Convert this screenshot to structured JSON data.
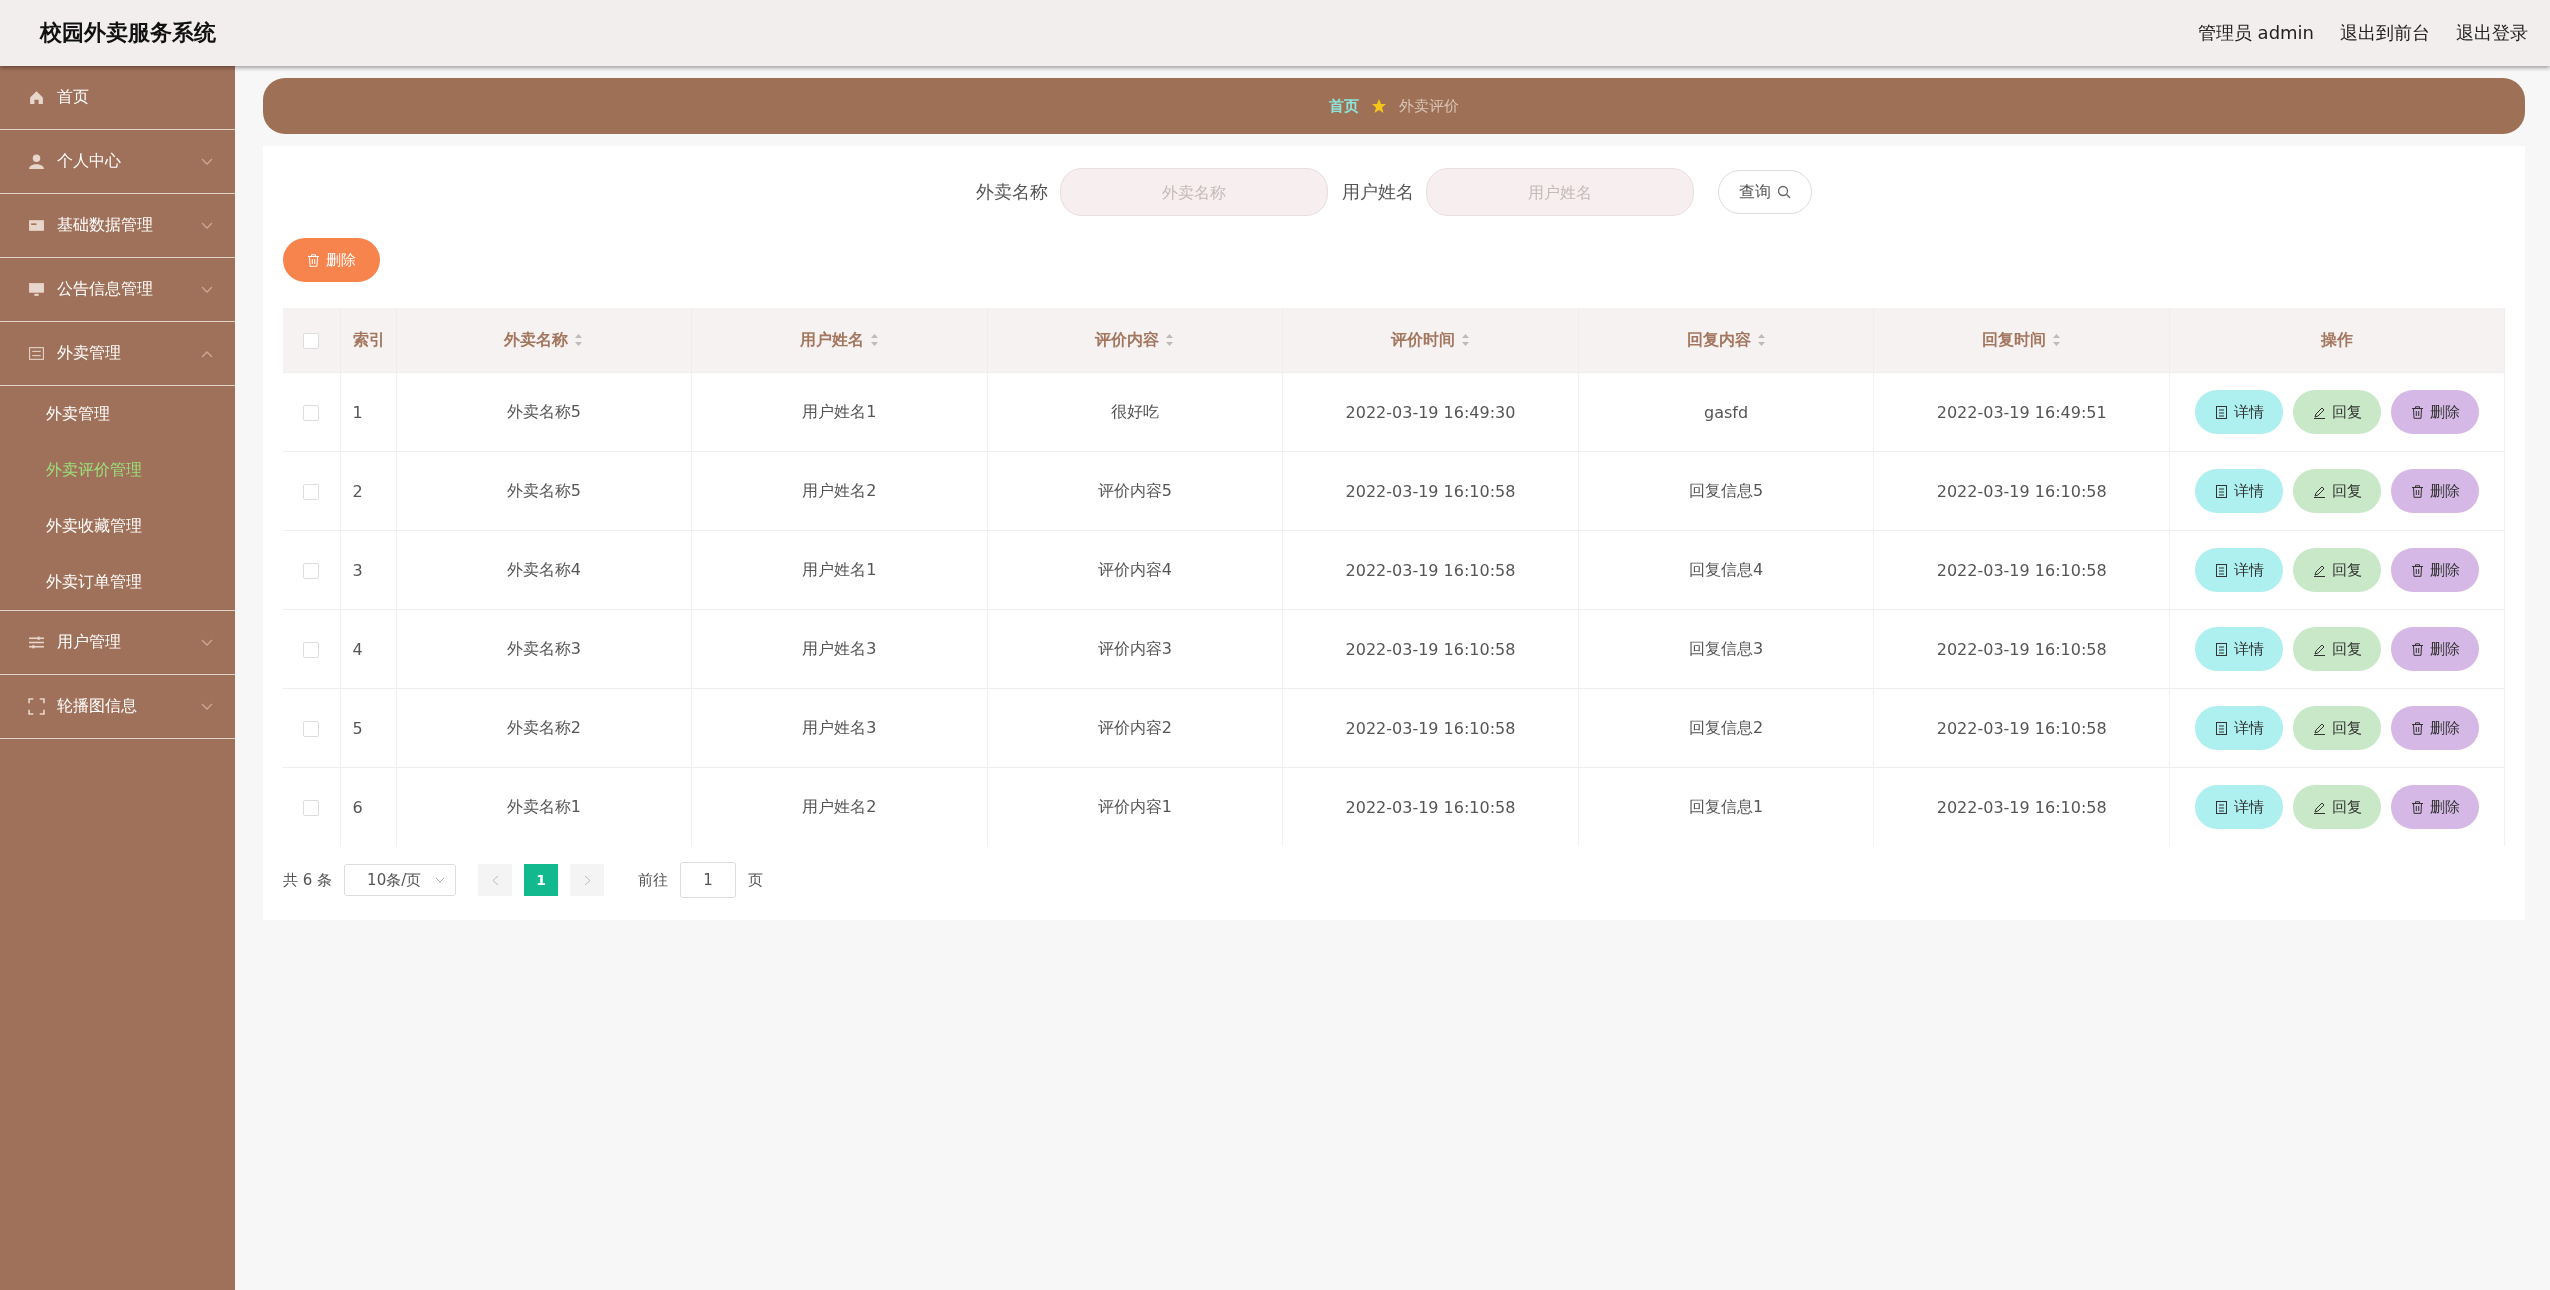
{
  "header": {
    "title": "校园外卖服务系统",
    "links": [
      "管理员 admin",
      "退出到前台",
      "退出登录"
    ]
  },
  "sidebar": {
    "items": [
      {
        "label": "首页"
      },
      {
        "label": "个人中心",
        "expanded": false
      },
      {
        "label": "基础数据管理",
        "expanded": false
      },
      {
        "label": "公告信息管理",
        "expanded": false
      },
      {
        "label": "外卖管理",
        "expanded": true,
        "children": [
          {
            "label": "外卖管理",
            "selected": false
          },
          {
            "label": "外卖评价管理",
            "selected": true
          },
          {
            "label": "外卖收藏管理",
            "selected": false
          },
          {
            "label": "外卖订单管理",
            "selected": false
          }
        ]
      },
      {
        "label": "用户管理",
        "expanded": false
      },
      {
        "label": "轮播图信息",
        "expanded": false
      }
    ]
  },
  "breadcrumb": [
    "首页",
    "外卖评价"
  ],
  "search": {
    "fields": [
      {
        "label": "外卖名称",
        "placeholder": "外卖名称"
      },
      {
        "label": "用户姓名",
        "placeholder": "用户姓名"
      }
    ],
    "button": "查询"
  },
  "delete_button": "删除",
  "table": {
    "all_checked": false,
    "columns": [
      {
        "label": "索引",
        "sortable": false
      },
      {
        "label": "外卖名称",
        "sortable": true
      },
      {
        "label": "用户姓名",
        "sortable": true
      },
      {
        "label": "评价内容",
        "sortable": true
      },
      {
        "label": "评价时间",
        "sortable": true
      },
      {
        "label": "回复内容",
        "sortable": true
      },
      {
        "label": "回复时间",
        "sortable": true
      },
      {
        "label": "操作",
        "sortable": false
      }
    ],
    "rows": [
      {
        "checked": false,
        "cells": [
          "1",
          "外卖名称5",
          "用户姓名1",
          "很好吃",
          "2022-03-19 16:49:30",
          "gasfd",
          "2022-03-19 16:49:51"
        ],
        "actions": [
          {
            "kind": "detail",
            "label": "详情"
          },
          {
            "kind": "reply",
            "label": "回复"
          },
          {
            "kind": "delete",
            "label": "删除"
          }
        ]
      },
      {
        "checked": false,
        "cells": [
          "2",
          "外卖名称5",
          "用户姓名2",
          "评价内容5",
          "2022-03-19 16:10:58",
          "回复信息5",
          "2022-03-19 16:10:58"
        ],
        "actions": [
          {
            "kind": "detail",
            "label": "详情"
          },
          {
            "kind": "reply",
            "label": "回复"
          },
          {
            "kind": "delete",
            "label": "删除"
          }
        ]
      },
      {
        "checked": false,
        "cells": [
          "3",
          "外卖名称4",
          "用户姓名1",
          "评价内容4",
          "2022-03-19 16:10:58",
          "回复信息4",
          "2022-03-19 16:10:58"
        ],
        "actions": [
          {
            "kind": "detail",
            "label": "详情"
          },
          {
            "kind": "reply",
            "label": "回复"
          },
          {
            "kind": "delete",
            "label": "删除"
          }
        ]
      },
      {
        "checked": false,
        "cells": [
          "4",
          "外卖名称3",
          "用户姓名3",
          "评价内容3",
          "2022-03-19 16:10:58",
          "回复信息3",
          "2022-03-19 16:10:58"
        ],
        "actions": [
          {
            "kind": "detail",
            "label": "详情"
          },
          {
            "kind": "reply",
            "label": "回复"
          },
          {
            "kind": "delete",
            "label": "删除"
          }
        ]
      },
      {
        "checked": false,
        "cells": [
          "5",
          "外卖名称2",
          "用户姓名3",
          "评价内容2",
          "2022-03-19 16:10:58",
          "回复信息2",
          "2022-03-19 16:10:58"
        ],
        "actions": [
          {
            "kind": "detail",
            "label": "详情"
          },
          {
            "kind": "reply",
            "label": "回复"
          },
          {
            "kind": "delete",
            "label": "删除"
          }
        ]
      },
      {
        "checked": false,
        "cells": [
          "6",
          "外卖名称1",
          "用户姓名2",
          "评价内容1",
          "2022-03-19 16:10:58",
          "回复信息1",
          "2022-03-19 16:10:58"
        ],
        "actions": [
          {
            "kind": "detail",
            "label": "详情"
          },
          {
            "kind": "reply",
            "label": "回复"
          },
          {
            "kind": "delete",
            "label": "删除"
          }
        ]
      }
    ]
  },
  "pagination": {
    "total": "共 6 条",
    "page_size": "10条/页",
    "pages": [
      {
        "label": "1",
        "selected": true
      }
    ],
    "goto_label": "前往",
    "goto_value": "1",
    "goto_suffix": "页"
  }
}
